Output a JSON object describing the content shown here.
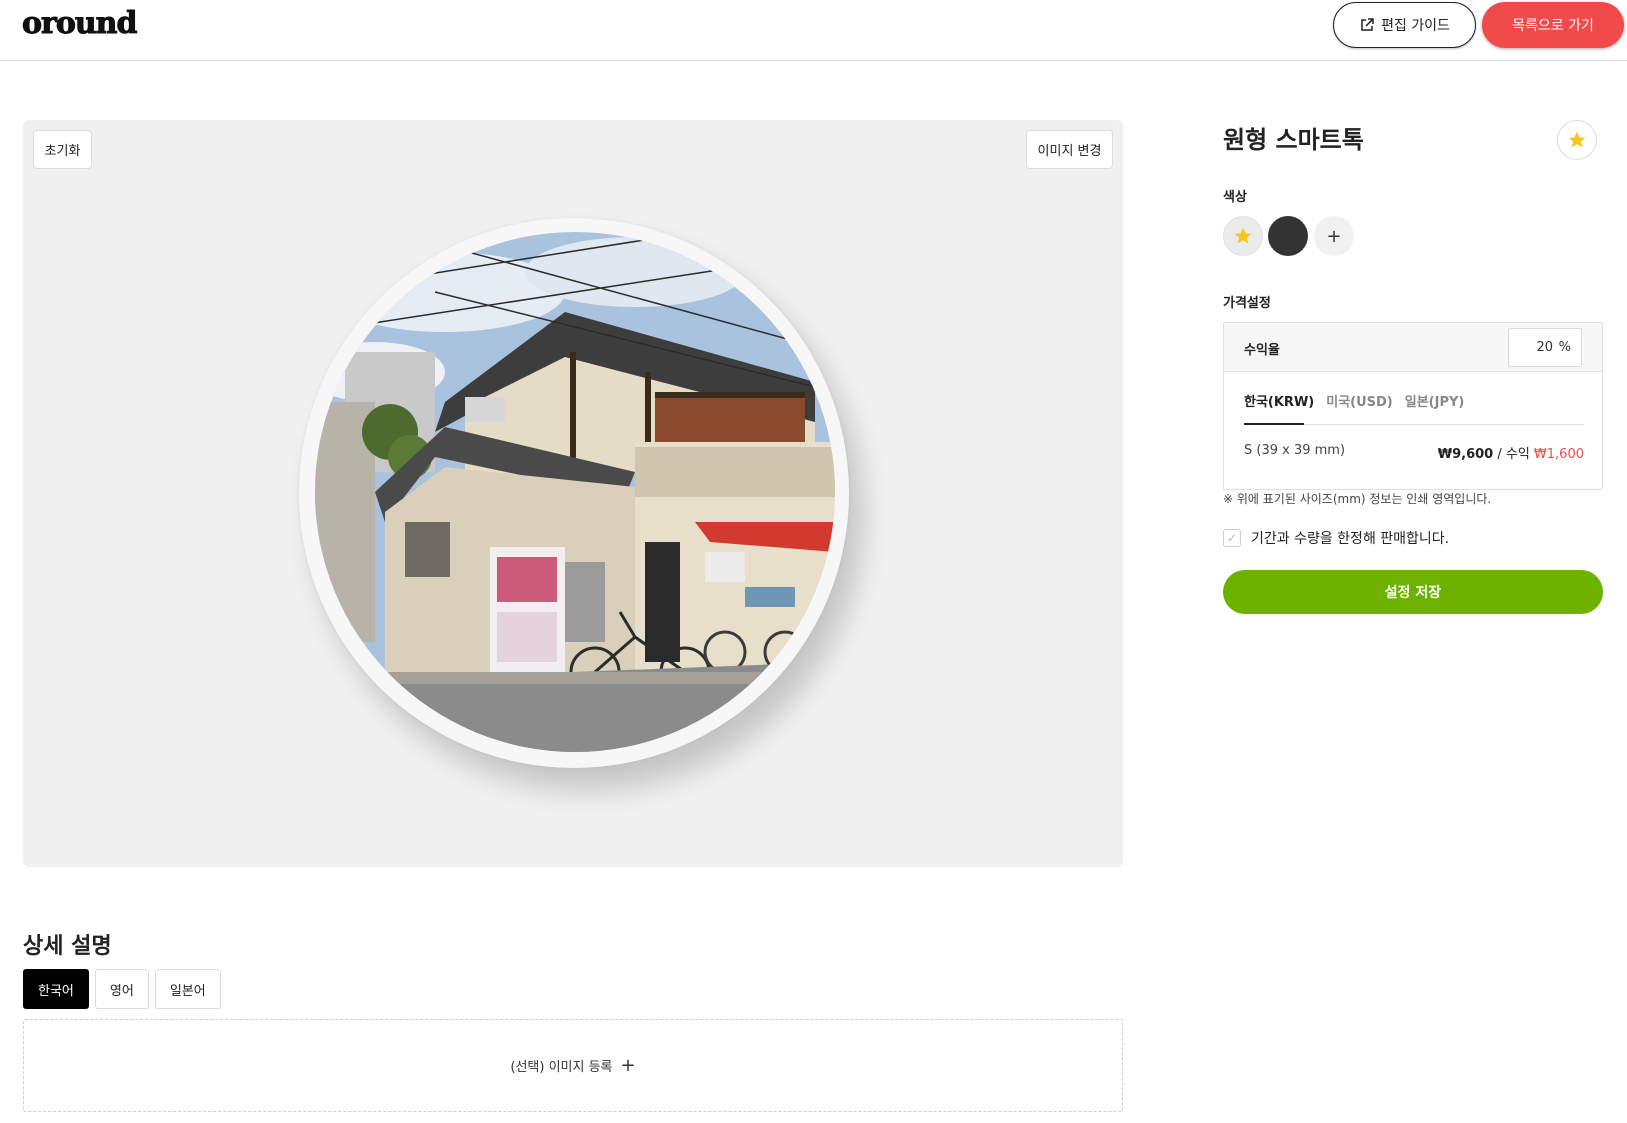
{
  "header": {
    "logo": "oround",
    "guide_button": "편집 가이드",
    "list_button": "목록으로 가기"
  },
  "editor": {
    "reset_button": "초기화",
    "change_image_button": "이미지 변경"
  },
  "product": {
    "title": "원형 스마트톡",
    "color_label": "색상",
    "colors": {
      "selected": "#f5c518",
      "second": "#333333"
    },
    "add_color": "+",
    "price_label": "가격설정",
    "margin_label": "수익율",
    "margin_value": "20",
    "margin_unit": "%",
    "currency_tabs": [
      "한국(KRW)",
      "미국(USD)",
      "일본(JPY)"
    ],
    "size_label": "S (39 x 39 mm)",
    "price": "₩9,600",
    "profit_prefix": " / 수익 ",
    "profit": "₩1,600",
    "note": "※ 위에 표기된 사이즈(mm) 정보는 인쇄 영역입니다.",
    "limit_label": "기간과 수량을 한정해 판매합니다.",
    "save_button": "설정 저장"
  },
  "description": {
    "title": "상세 설명",
    "tabs": [
      "한국어",
      "영어",
      "일본어"
    ],
    "upload_label": "(선택) 이미지 등록",
    "upload_plus": "+"
  },
  "colors": {
    "accent_red": "#f04a4a",
    "accent_green": "#6eb200",
    "star_yellow": "#f5c518"
  }
}
